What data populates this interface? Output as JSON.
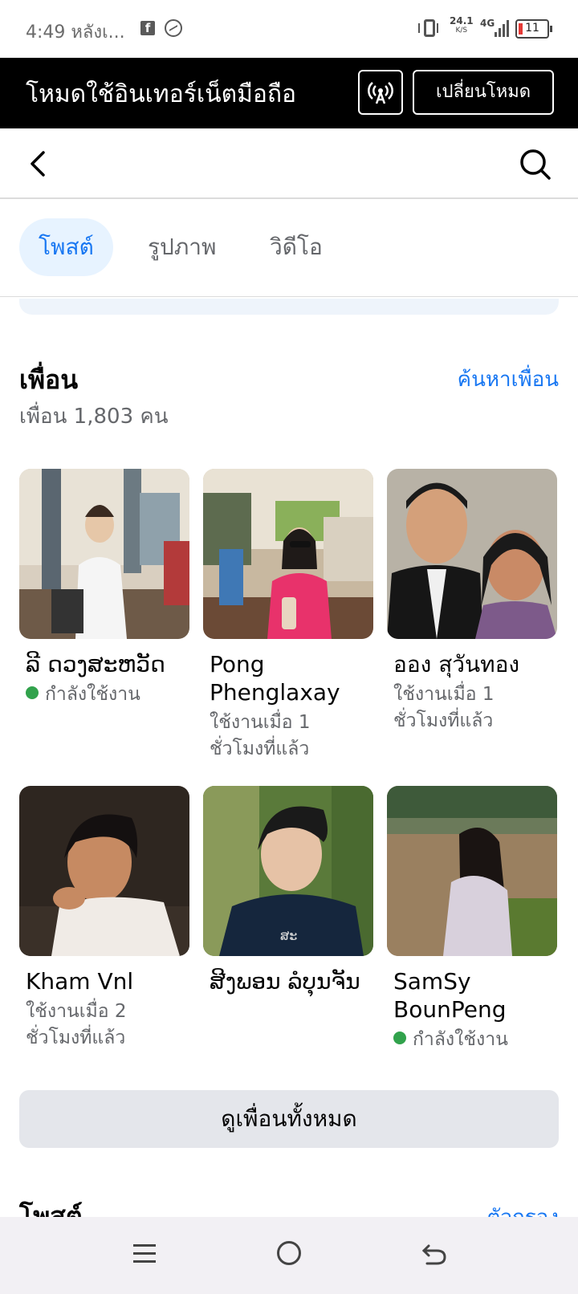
{
  "status_bar": {
    "time": "4:49 หลังเ...",
    "speed_value": "24.1",
    "speed_unit": "K/S",
    "network": "4G",
    "battery": "11"
  },
  "banner": {
    "text": "โหมดใช้อินเทอร์เน็ตมือถือ",
    "switch_label": "เปลี่ยนโหมด"
  },
  "tabs": [
    {
      "label": "โพสต์",
      "active": true
    },
    {
      "label": "รูปภาพ",
      "active": false
    },
    {
      "label": "วิดีโอ",
      "active": false
    }
  ],
  "friends": {
    "title": "เพื่อน",
    "find_label": "ค้นหาเพื่อน",
    "count_text": "เพื่อน 1,803 คน",
    "items": [
      {
        "name": "ລີ ດວງສະຫວັດ",
        "status": "กำลังใช้งาน",
        "online": true
      },
      {
        "name": "Pong Phenglaxay",
        "status": "ใช้งานเมื่อ 1 ชั่วโมงที่แล้ว",
        "online": false
      },
      {
        "name": "ออง สุวันทอง",
        "status": "ใช้งานเมื่อ 1 ชั่วโมงที่แล้ว",
        "online": false
      },
      {
        "name": "Kham Vnl",
        "status": "ใช้งานเมื่อ 2 ชั่วโมงที่แล้ว",
        "online": false
      },
      {
        "name": "ສີງພອນ ລໍບຸນຈັນ",
        "status": "",
        "online": false
      },
      {
        "name": "SamSy BounPeng",
        "status": "กำลังใช้งาน",
        "online": true
      }
    ],
    "see_all_label": "ดูเพื่อนทั้งหมด"
  },
  "posts": {
    "title": "โพสต์",
    "link_label": "ตัวกรอง"
  },
  "colors": {
    "accent": "#1877f2",
    "active_tab_bg": "#e7f3ff",
    "online": "#31a24c",
    "banner_bg": "#000000"
  },
  "icons": {
    "back": "back-arrow-icon",
    "search": "search-icon",
    "hotspot": "hotspot-icon",
    "nav_menu": "menu-icon",
    "nav_home": "home-circle-icon",
    "nav_back": "back-gesture-icon"
  }
}
